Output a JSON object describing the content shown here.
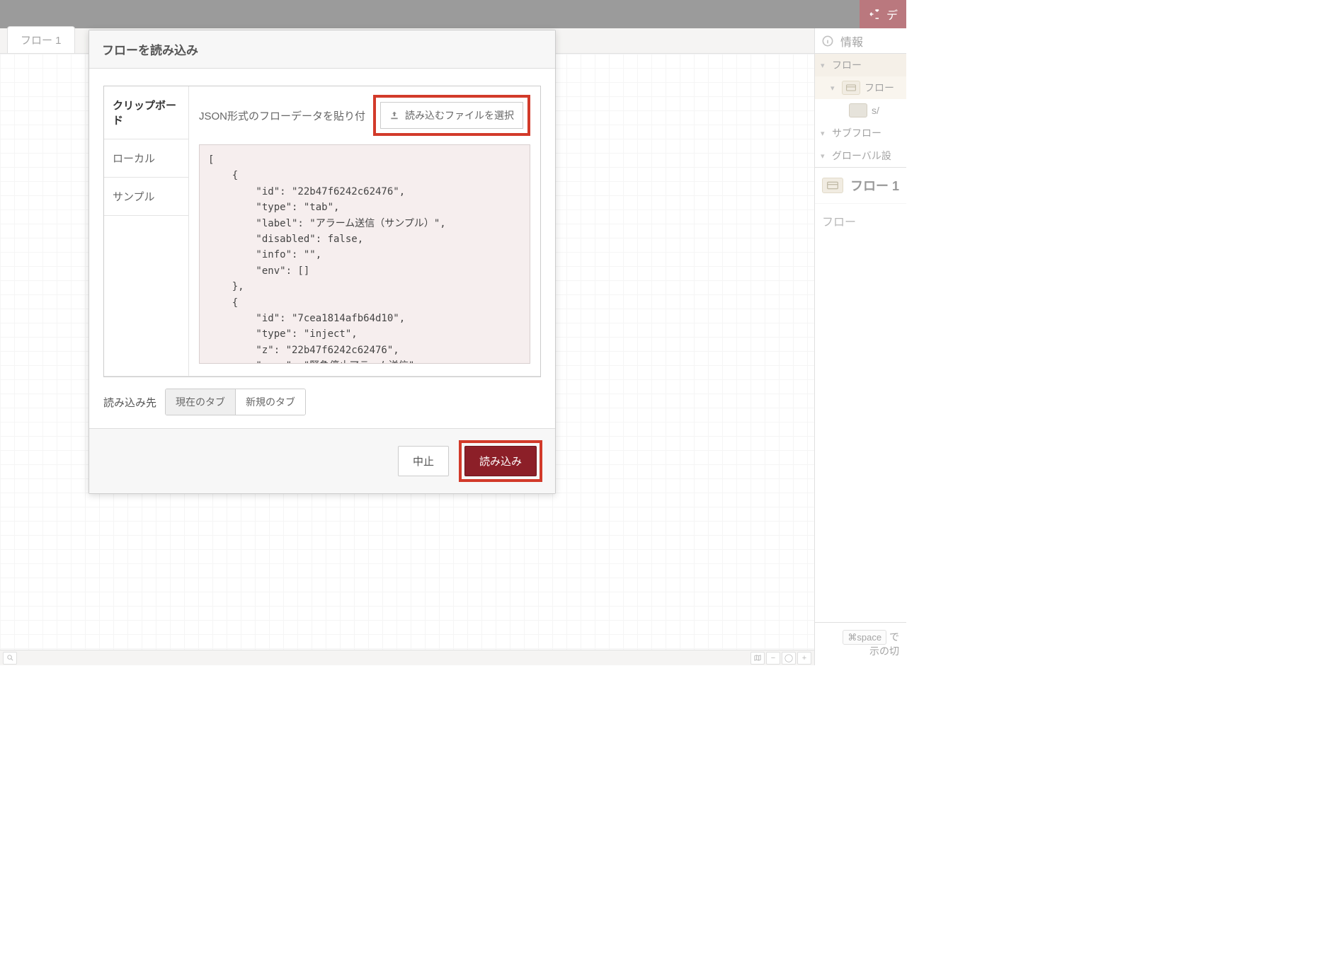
{
  "topbar": {
    "deploy_label": "デ"
  },
  "workspace": {
    "tab_label": "フロー 1"
  },
  "sidebar": {
    "header_title": "情報",
    "tree": {
      "flows_label": "フロー",
      "flow1_label": "フロー",
      "node_label": "s/",
      "subflows_label": "サブフロー",
      "globals_label": "グローバル設"
    },
    "detail": {
      "title": "フロー 1",
      "subtitle": "フロー"
    },
    "footer": {
      "key_hint": "⌘space",
      "hint_tail": "で",
      "hint_line2": "示の切"
    }
  },
  "modal": {
    "title": "フローを読み込み",
    "tabs": {
      "clipboard": "クリップボード",
      "local": "ローカル",
      "sample": "サンプル"
    },
    "paste_label": "JSON形式のフローデータを貼り付け",
    "file_button": "読み込むファイルを選択",
    "json_value": "[\n    {\n        \"id\": \"22b47f6242c62476\",\n        \"type\": \"tab\",\n        \"label\": \"アラーム送信（サンプル）\",\n        \"disabled\": false,\n        \"info\": \"\",\n        \"env\": []\n    },\n    {\n        \"id\": \"7cea1814afb64d10\",\n        \"type\": \"inject\",\n        \"z\": \"22b47f6242c62476\",\n        \"name\": \"緊急停止アラーム送信\",\n        \"props\": [\n            {\n                \"p\": \"payload\"\n            }\n        ],",
    "dest_label": "読み込み先",
    "dest_current": "現在のタブ",
    "dest_new": "新規のタブ",
    "cancel": "中止",
    "submit": "読み込み"
  },
  "footer_icons": {
    "search": "search",
    "map": "map",
    "minus": "−",
    "zero": "◯",
    "plus": "+"
  }
}
